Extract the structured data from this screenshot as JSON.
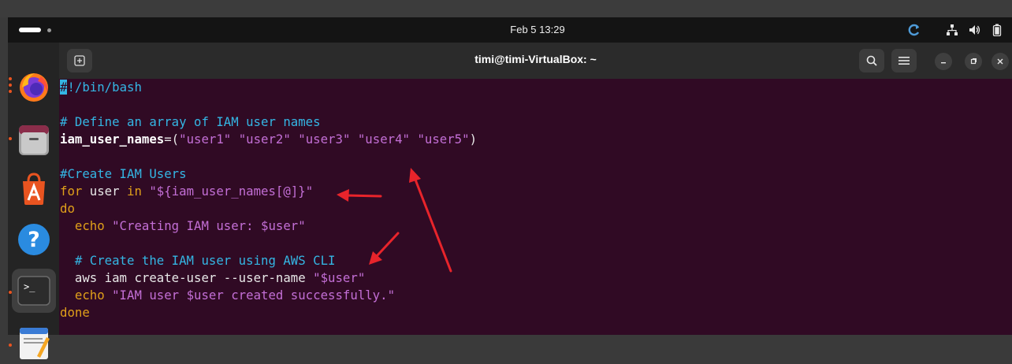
{
  "topbar": {
    "clock": "Feb 5  13:29"
  },
  "tray": {
    "icons": [
      "sync-icon",
      "network-icon",
      "volume-icon",
      "battery-icon"
    ]
  },
  "dock": {
    "apps": [
      "firefox",
      "files",
      "app-center",
      "help",
      "terminal",
      "text-editor"
    ]
  },
  "window": {
    "title": "timi@timi-VirtualBox: ~"
  },
  "code": {
    "l1_cursor": "#",
    "l1_rest": "!/bin/bash",
    "l3_comment": "# Define an array of IAM user names",
    "l4_var": "iam_user_names",
    "l4_eq": "=(",
    "l4_s1": "\"user1\"",
    "l4_s2": "\"user2\"",
    "l4_s3": "\"user3\"",
    "l4_s4": "\"user4\"",
    "l4_s5": "\"user5\"",
    "l4_close": ")",
    "l6_comment": "#Create IAM Users",
    "l7_for": "for",
    "l7_user": " user ",
    "l7_in": "in",
    "l7_space": " ",
    "l7_q1": "\"${",
    "l7_expr": "iam_user_names[@]",
    "l7_q2": "}\"",
    "l8_do": "do",
    "l9_indent": "  ",
    "l9_echo": "echo",
    "l9_str": " \"Creating IAM user: $user\"",
    "l11_indent": "  ",
    "l11_comment": "# Create the IAM user using AWS CLI",
    "l12_indent": "  ",
    "l12_cmd": "aws iam create-user --user-name ",
    "l12_q1": "\"",
    "l12_var": "$user",
    "l12_q2": "\"",
    "l13_indent": "  ",
    "l13_echo": "echo",
    "l13_str": " \"IAM user $user created successfully.\"",
    "l14_done": "done"
  },
  "colors": {
    "terminal_bg": "#300a24",
    "comment": "#34b6e4",
    "keyword": "#e0a01a",
    "string": "#c36fd6",
    "annotation_arrow": "#e8242b"
  }
}
